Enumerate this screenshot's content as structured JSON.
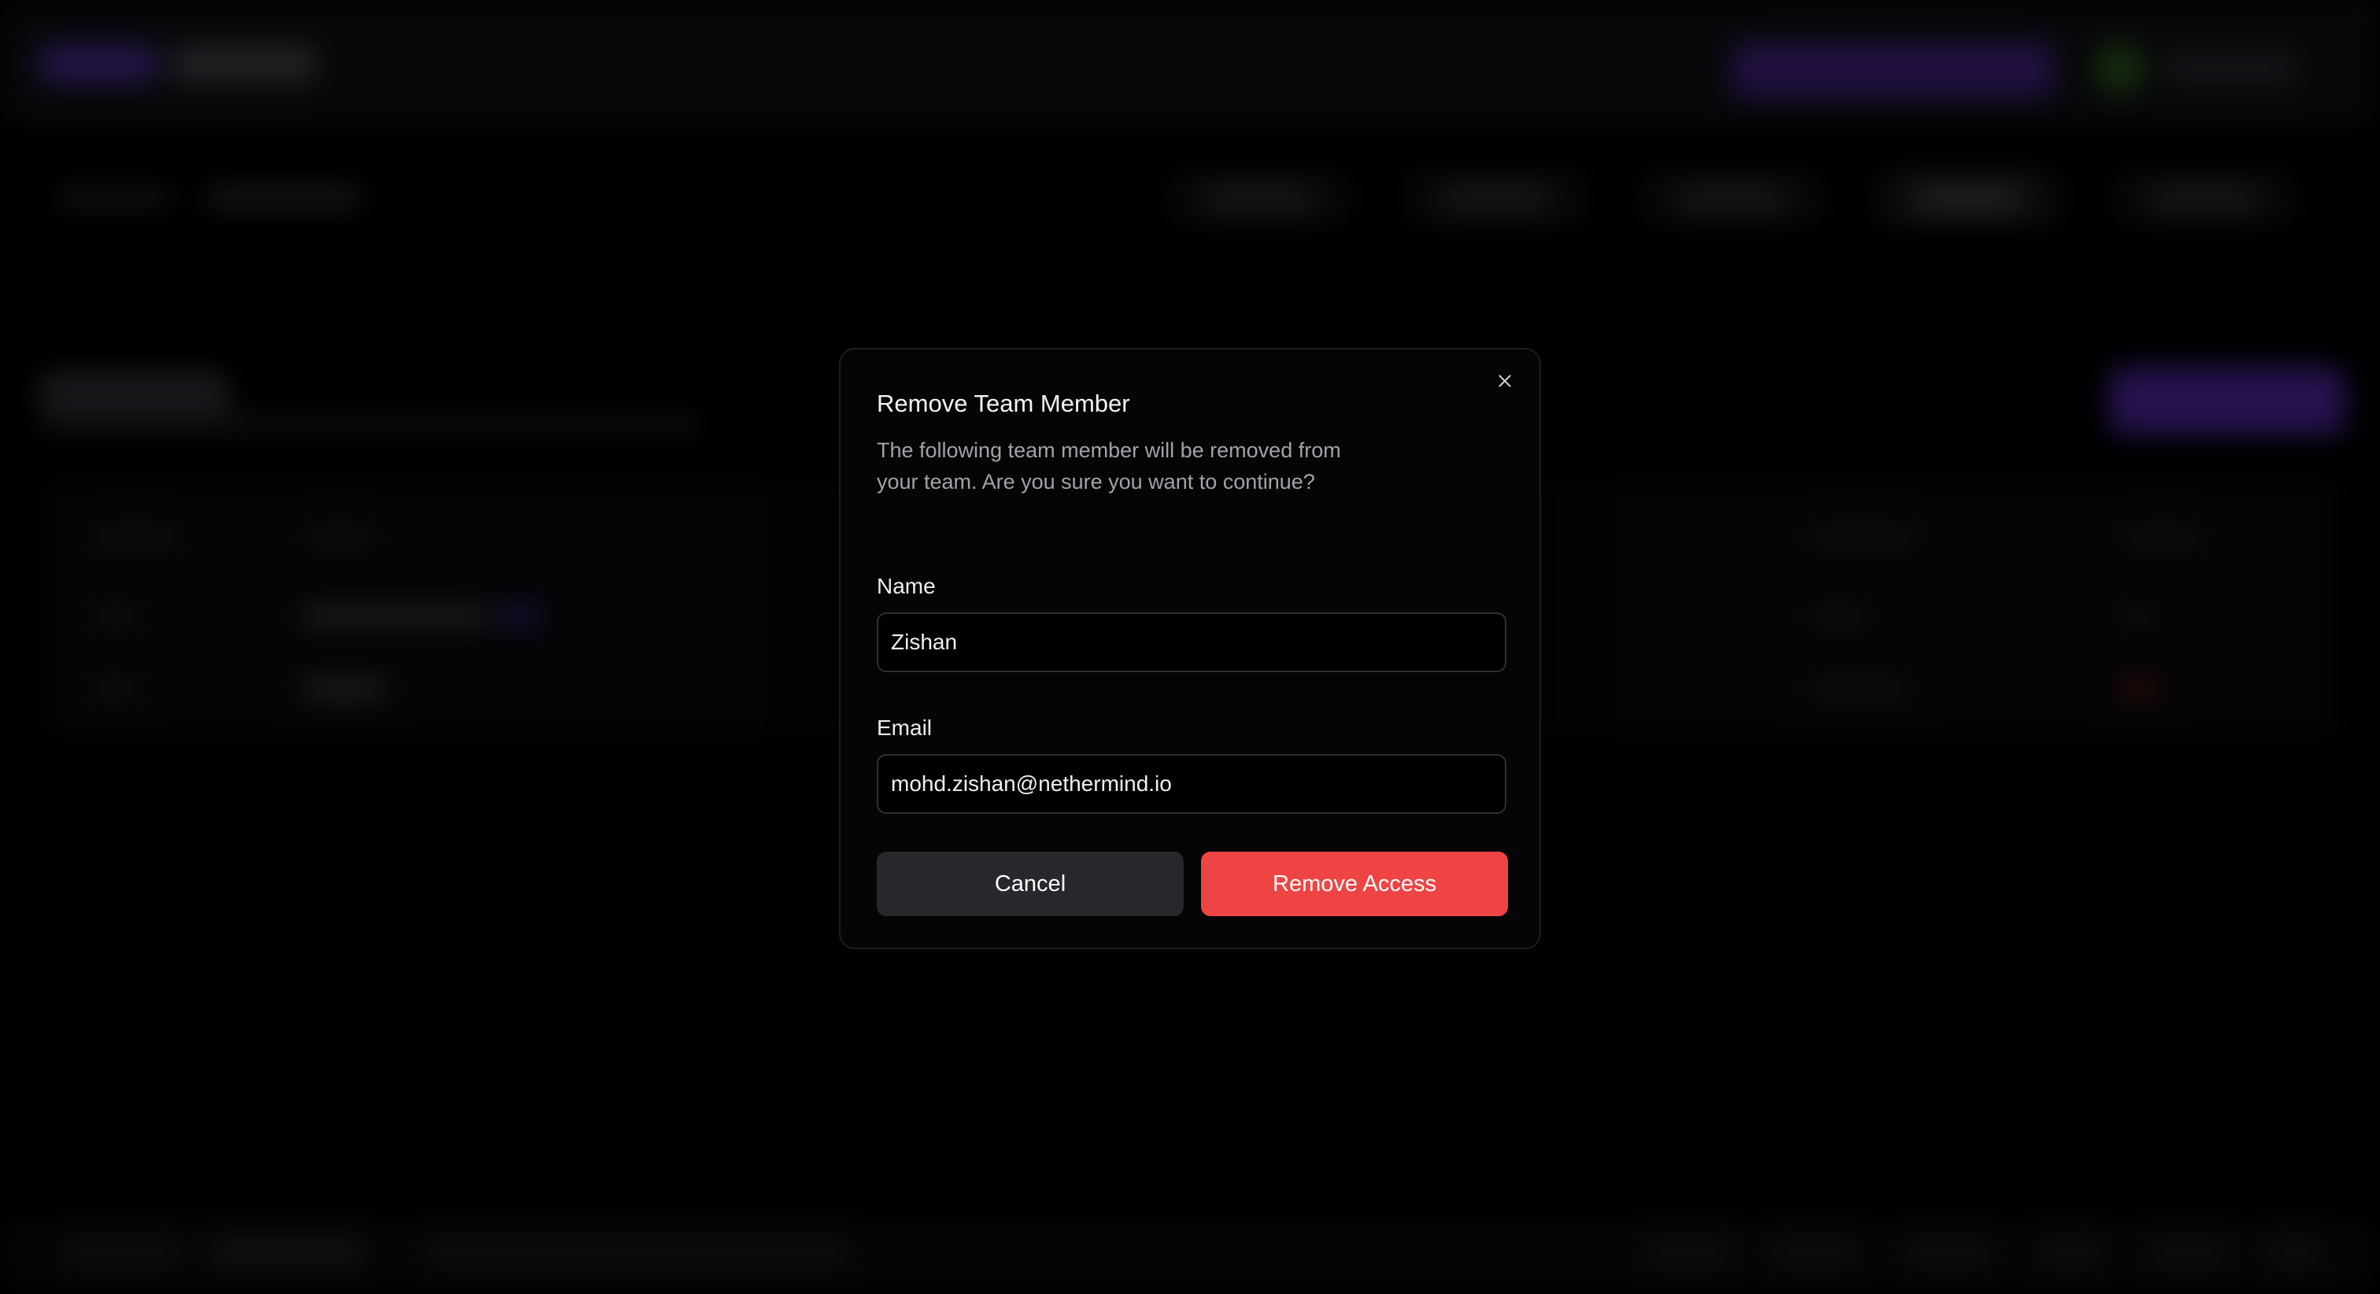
{
  "modal": {
    "title": "Remove Team Member",
    "description": "The following team member will be removed from your team. Are you sure you want to continue?",
    "close_icon": "close-icon",
    "name_label": "Name",
    "name_value": "Zishan",
    "email_label": "Email",
    "email_value": "mohd.zishan@nethermind.io",
    "cancel_label": "Cancel",
    "remove_label": "Remove Access"
  },
  "colors": {
    "danger": "#ef4444",
    "cancel_bg": "#27272c",
    "modal_bg": "#050506",
    "accent": "#6b37e0"
  }
}
